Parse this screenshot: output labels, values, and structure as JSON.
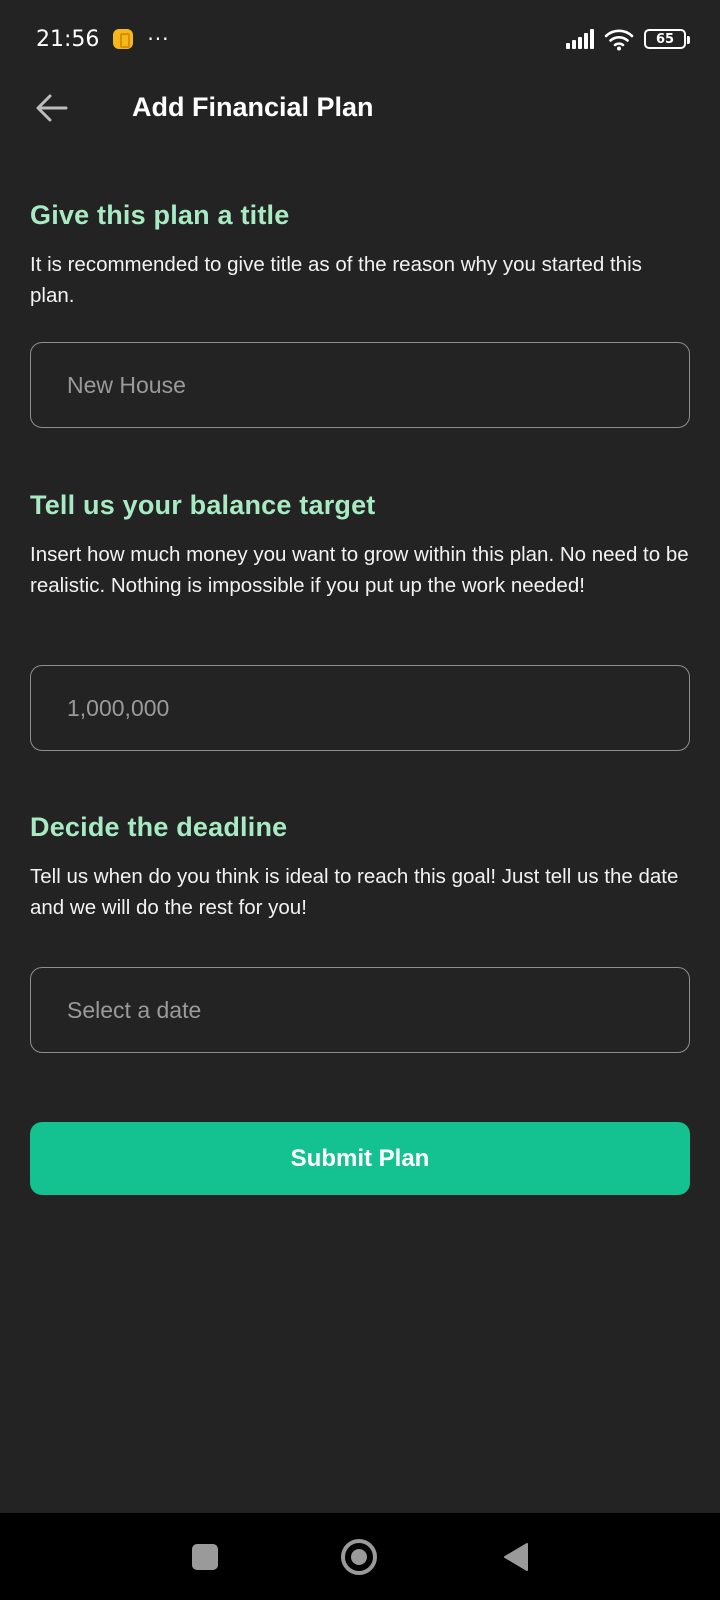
{
  "status_bar": {
    "time": "21:56",
    "more": "···",
    "battery": "65",
    "icons": [
      "notification-icon",
      "signal-icon",
      "wifi-icon",
      "battery-icon"
    ]
  },
  "app_bar": {
    "title": "Add Financial Plan",
    "back_icon": "arrow-left-icon"
  },
  "sections": [
    {
      "title": "Give this plan a title",
      "description": "It is recommended to give title as of the reason why you started this plan.",
      "input": {
        "value": "",
        "placeholder": "New House"
      }
    },
    {
      "title": "Tell us your balance target",
      "description": "Insert how much money you want to grow within this plan. No need to be realistic. Nothing is impossible if you put up the work needed!",
      "input": {
        "value": "",
        "placeholder": "1,000,000"
      }
    },
    {
      "title": "Decide the deadline",
      "description": "Tell us when do you think is ideal to reach this goal! Just tell us the date and we will do the rest for you!",
      "input": {
        "value": "",
        "placeholder": "Select a date"
      }
    }
  ],
  "submit_label": "Submit Plan",
  "colors": {
    "background": "#232323",
    "accent_title": "#a8ebc3",
    "button": "#14c190",
    "border": "#8e8e8e"
  },
  "nav_bar": {
    "icons": [
      "recent-apps-icon",
      "home-icon",
      "back-triangle-icon"
    ]
  }
}
